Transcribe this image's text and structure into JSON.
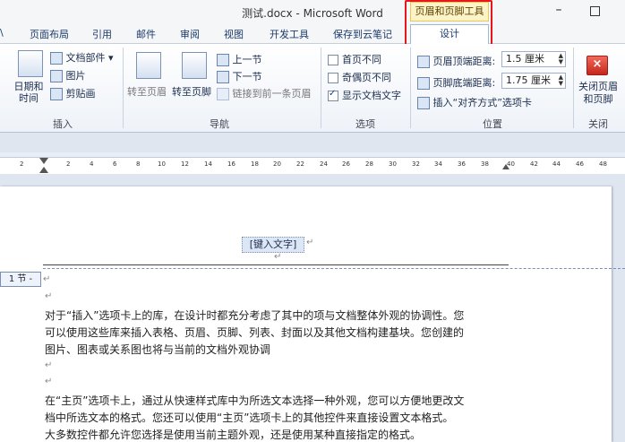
{
  "window": {
    "title": "测试.docx - Microsoft Word",
    "context_title": "页眉和页脚工具",
    "min_glyph": "–"
  },
  "tabs": [
    "\\",
    "页面布局",
    "引用",
    "邮件",
    "审阅",
    "视图",
    "开发工具",
    "保存到云笔记"
  ],
  "active_tab": "设计",
  "ribbon": {
    "insert_group": {
      "label": "插入",
      "datetime": "日期和\n时间",
      "docparts": "文档部件 ▾",
      "picture": "图片",
      "clipart": "剪贴画"
    },
    "nav_group": {
      "label": "导航",
      "goto_header": "转至页眉",
      "goto_footer": "转至页脚",
      "prev_section": "上一节",
      "next_section": "下一节",
      "link_prev": "链接到前一条页眉"
    },
    "options_group": {
      "label": "选项",
      "first_page": "首页不同",
      "odd_even": "奇偶页不同",
      "show_text": "显示文档文字"
    },
    "position_group": {
      "label": "位置",
      "header_dist_label": "页眉顶端距离:",
      "header_dist_value": "1.5 厘米",
      "footer_dist_label": "页脚底端距离:",
      "footer_dist_value": "1.75 厘米",
      "insert_align": "插入“对齐方式”选项卡"
    },
    "close_group": {
      "label": "关闭",
      "close_btn": "关闭页眉\n和页脚"
    }
  },
  "ruler": {
    "ticks": [
      "2",
      "2",
      "4",
      "6",
      "8",
      "10",
      "12",
      "14",
      "16",
      "18",
      "20",
      "22",
      "24",
      "26",
      "28",
      "30",
      "32",
      "34",
      "36",
      "38",
      "40",
      "42",
      "44",
      "46",
      "48"
    ]
  },
  "document": {
    "header_field": "[键入文字]",
    "section_tag": "1 节 -",
    "lines": [
      "对于“插入”选项卡上的库，在设计时都充分考虑了其中的项与文档整体外观的协调性。您",
      "可以使用这些库来插入表格、页眉、页脚、列表、封面以及其他文档构建基块。您创建的",
      "图片、图表或关系图也将与当前的文档外观协调",
      "在“主页”选项卡上，通过从快速样式库中为所选文本选择一种外观，您可以方便地更改文",
      "档中所选文本的格式。您还可以使用“主页”选项卡上的其他控件来直接设置文本格式。",
      "大多数控件都允许您选择是使用当前主题外观，还是使用某种直接指定的格式。"
    ],
    "para_mark": "↵"
  }
}
